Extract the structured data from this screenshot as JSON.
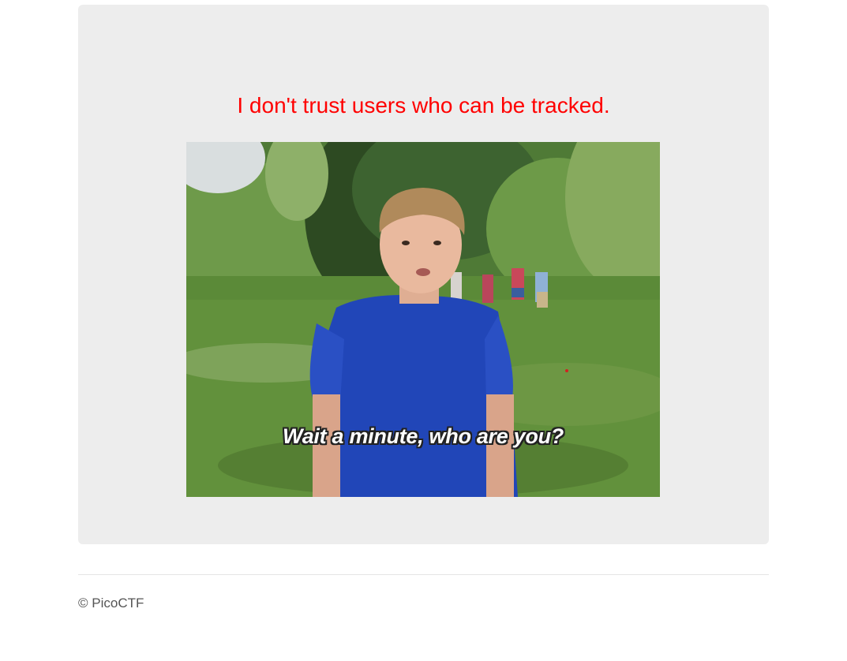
{
  "main": {
    "message": "I don't trust users who can be tracked.",
    "message_color": "#ff0000",
    "image": {
      "caption": "Wait a minute, who are you?"
    }
  },
  "footer": {
    "copyright": "© PicoCTF"
  }
}
